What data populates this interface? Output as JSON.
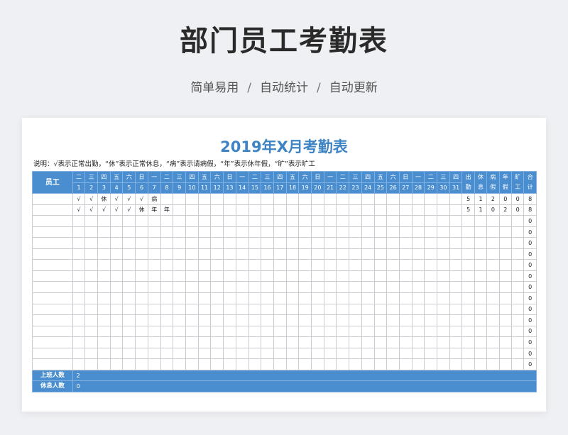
{
  "banner": {
    "title": "部门员工考勤表",
    "subtitle_parts": [
      "简单易用",
      "自动统计",
      "自动更新"
    ],
    "separator": "/"
  },
  "sheet": {
    "title": "2019年X月考勤表",
    "note": "说明：√表示正常出勤，“休”表示正常休息，“病”表示请病假，“年”表示休年假，“旷”表示旷工",
    "employee_header": "员工",
    "weekdays": [
      "二",
      "三",
      "四",
      "五",
      "六",
      "日",
      "一",
      "二",
      "三",
      "四",
      "五",
      "六",
      "日",
      "一",
      "二",
      "三",
      "四",
      "五",
      "六",
      "日",
      "一",
      "二",
      "三",
      "四",
      "五",
      "六",
      "日",
      "一",
      "二",
      "三",
      "四"
    ],
    "days": [
      "1",
      "2",
      "3",
      "4",
      "5",
      "6",
      "7",
      "8",
      "9",
      "10",
      "11",
      "12",
      "13",
      "14",
      "15",
      "16",
      "17",
      "18",
      "19",
      "20",
      "21",
      "22",
      "23",
      "24",
      "25",
      "26",
      "27",
      "28",
      "29",
      "30",
      "31"
    ],
    "summary_headers": [
      [
        "出",
        "勤"
      ],
      [
        "休",
        "息"
      ],
      [
        "病",
        "假"
      ],
      [
        "年",
        "假"
      ],
      [
        "旷",
        "工"
      ],
      [
        "合",
        "计"
      ]
    ],
    "rows": [
      {
        "name": "",
        "days": [
          "√",
          "√",
          "休",
          "√",
          "√",
          "√",
          "病",
          "",
          "",
          "",
          "",
          "",
          "",
          "",
          "",
          "",
          "",
          "",
          "",
          "",
          "",
          "",
          "",
          "",
          "",
          "",
          "",
          "",
          "",
          "",
          ""
        ],
        "stats": [
          "5",
          "1",
          "2",
          "0",
          "0",
          "8"
        ]
      },
      {
        "name": "",
        "days": [
          "√",
          "√",
          "√",
          "√",
          "√",
          "休",
          "年",
          "年",
          "",
          "",
          "",
          "",
          "",
          "",
          "",
          "",
          "",
          "",
          "",
          "",
          "",
          "",
          "",
          "",
          "",
          "",
          "",
          "",
          "",
          "",
          ""
        ],
        "stats": [
          "5",
          "1",
          "0",
          "2",
          "0",
          "8"
        ]
      },
      {
        "name": "",
        "days": [],
        "stats": [
          "",
          "",
          "",
          "",
          "",
          "0"
        ]
      },
      {
        "name": "",
        "days": [],
        "stats": [
          "",
          "",
          "",
          "",
          "",
          "0"
        ]
      },
      {
        "name": "",
        "days": [],
        "stats": [
          "",
          "",
          "",
          "",
          "",
          "0"
        ]
      },
      {
        "name": "",
        "days": [],
        "stats": [
          "",
          "",
          "",
          "",
          "",
          "0"
        ]
      },
      {
        "name": "",
        "days": [],
        "stats": [
          "",
          "",
          "",
          "",
          "",
          "0"
        ]
      },
      {
        "name": "",
        "days": [],
        "stats": [
          "",
          "",
          "",
          "",
          "",
          "0"
        ]
      },
      {
        "name": "",
        "days": [],
        "stats": [
          "",
          "",
          "",
          "",
          "",
          "0"
        ]
      },
      {
        "name": "",
        "days": [],
        "stats": [
          "",
          "",
          "",
          "",
          "",
          "0"
        ]
      },
      {
        "name": "",
        "days": [],
        "stats": [
          "",
          "",
          "",
          "",
          "",
          "0"
        ]
      },
      {
        "name": "",
        "days": [],
        "stats": [
          "",
          "",
          "",
          "",
          "",
          "0"
        ]
      },
      {
        "name": "",
        "days": [],
        "stats": [
          "",
          "",
          "",
          "",
          "",
          "0"
        ]
      },
      {
        "name": "",
        "days": [],
        "stats": [
          "",
          "",
          "",
          "",
          "",
          "0"
        ]
      },
      {
        "name": "",
        "days": [],
        "stats": [
          "",
          "",
          "",
          "",
          "",
          "0"
        ]
      },
      {
        "name": "",
        "days": [],
        "stats": [
          "",
          "",
          "",
          "",
          "",
          "0"
        ]
      }
    ],
    "footer": [
      {
        "label": "上班人数",
        "value": "2"
      },
      {
        "label": "休息人数",
        "value": "0"
      }
    ]
  },
  "colors": {
    "header_blue": "#4a8ed0",
    "title_blue": "#3e84c4"
  }
}
